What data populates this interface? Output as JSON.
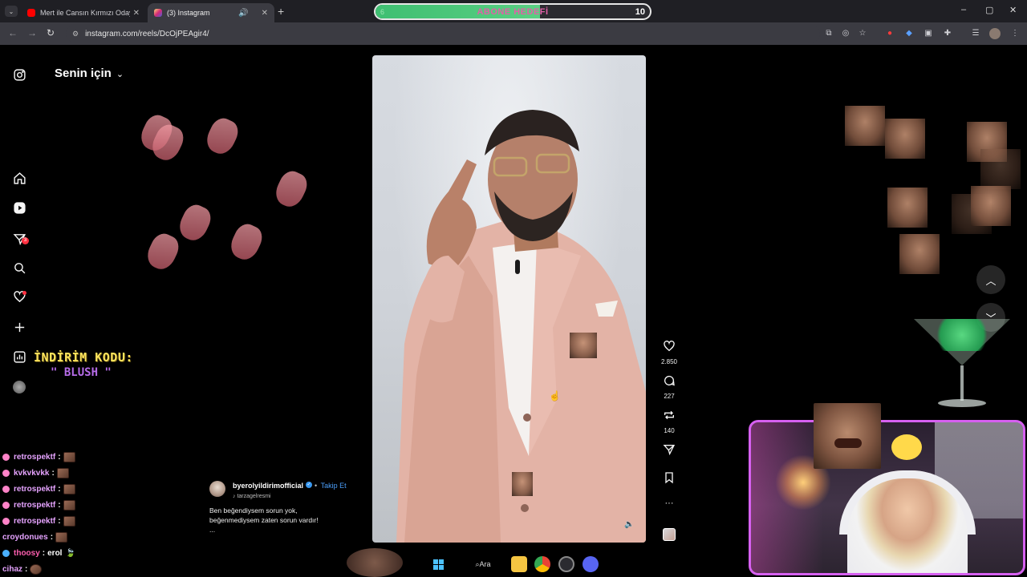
{
  "browser": {
    "tabs": [
      {
        "title": "Mert ile Cansın Kırmızı Odaya g",
        "active": false,
        "favicon_color": "#ff0000"
      },
      {
        "title": "(3) Instagram",
        "active": true,
        "favicon_color": "#d62976"
      }
    ],
    "new_tab_label": "+",
    "url": "instagram.com/reels/DcOjPEAgir4/",
    "window_controls": [
      "–",
      "▢",
      "✕"
    ]
  },
  "stream_goal": {
    "label": "ABONE HEDEFİ",
    "current": "6",
    "target": "10",
    "progress_fraction": 0.6,
    "fill_color": "#4cc97a"
  },
  "instagram": {
    "header": {
      "title": "Senin için",
      "chevron": "⌄"
    },
    "nav": {
      "icons": [
        "instagram-logo-icon",
        "home-icon",
        "reels-icon",
        "direct-messages-icon",
        "search-icon",
        "notifications-icon",
        "create-icon",
        "dashboard-icon",
        "profile-avatar"
      ],
      "messages_badge": "3"
    },
    "post": {
      "author": "byerolyildirimofficial",
      "verified": true,
      "follow_label": "Takip Et",
      "bullet": "•",
      "audio": "tarzagelresmi",
      "caption_line1": "Ben beğendiysem sorun yok,",
      "caption_line2": "beğenmediysem zaten sorun vardır!",
      "more": "..."
    },
    "actions": {
      "likes": "2.850",
      "comments": "227",
      "reposts": "140",
      "more_label": "···"
    }
  },
  "overlay": {
    "promo_title": "İNDİRİM KODU:",
    "promo_code": "\" BLUSH \"",
    "chat": [
      {
        "user": "retrospektf",
        "sep": ":",
        "msg": ""
      },
      {
        "user": "kvkvkvkk",
        "sep": ":",
        "msg": ""
      },
      {
        "user": "retrospektf",
        "sep": ":",
        "msg": ""
      },
      {
        "user": "retrospektf",
        "sep": ":",
        "msg": ""
      },
      {
        "user": "retrospektf",
        "sep": ":",
        "msg": ""
      },
      {
        "user": "croydonues",
        "sep": ":",
        "msg": ""
      },
      {
        "user": "thoosy",
        "sep": ":",
        "msg": "erol"
      },
      {
        "user": "cihaz",
        "sep": ":",
        "msg": ""
      }
    ]
  },
  "taskbar": {
    "search_label": "Ara"
  }
}
